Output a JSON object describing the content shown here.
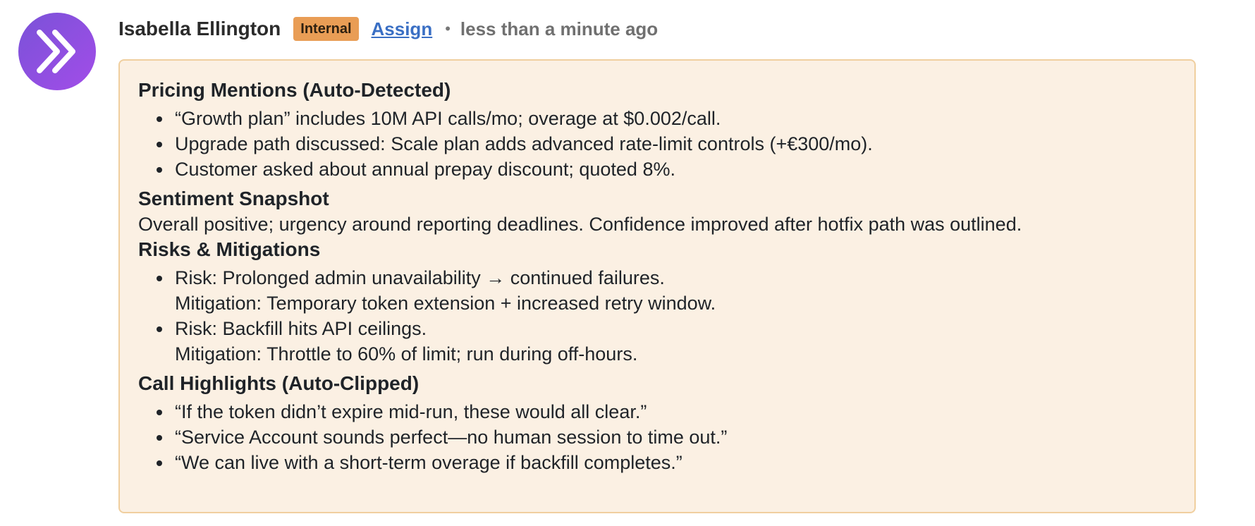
{
  "author": {
    "name": "Isabella Ellington",
    "tag": "Internal",
    "assign_label": "Assign",
    "separator": "•",
    "timestamp": "less than a minute ago",
    "avatar_icon": "double-chevron-right-icon"
  },
  "colors": {
    "avatar_start": "#7a52d8",
    "avatar_end": "#a24de8",
    "tag_bg": "#e99d55",
    "link": "#3a6fc4",
    "card_bg": "#fbf0e3",
    "card_border": "#f0cf9f"
  },
  "sections": {
    "pricing": {
      "title": "Pricing Mentions (Auto-Detected)",
      "items": [
        "“Growth plan” includes 10M API calls/mo; overage at $0.002/call.",
        "Upgrade path discussed: Scale plan adds advanced rate-limit controls (+€300/mo).",
        "Customer asked about annual prepay discount; quoted 8%."
      ]
    },
    "sentiment": {
      "title": "Sentiment Snapshot",
      "body": "Overall positive; urgency around reporting deadlines. Confidence improved after hotfix path was outlined."
    },
    "risks": {
      "title": "Risks & Mitigations",
      "items": [
        {
          "risk": "Risk: Prolonged admin unavailability → continued failures.",
          "mitigation": "Mitigation: Temporary token extension + increased retry window."
        },
        {
          "risk": "Risk: Backfill hits API ceilings.",
          "mitigation": "Mitigation: Throttle to 60% of limit; run during off-hours."
        }
      ]
    },
    "highlights": {
      "title": "Call Highlights (Auto-Clipped)",
      "items": [
        "“If the token didn’t expire mid-run, these would all clear.”",
        "“Service Account sounds perfect—no human session to time out.”",
        "“We can live with a short-term overage if backfill completes.”"
      ]
    }
  }
}
